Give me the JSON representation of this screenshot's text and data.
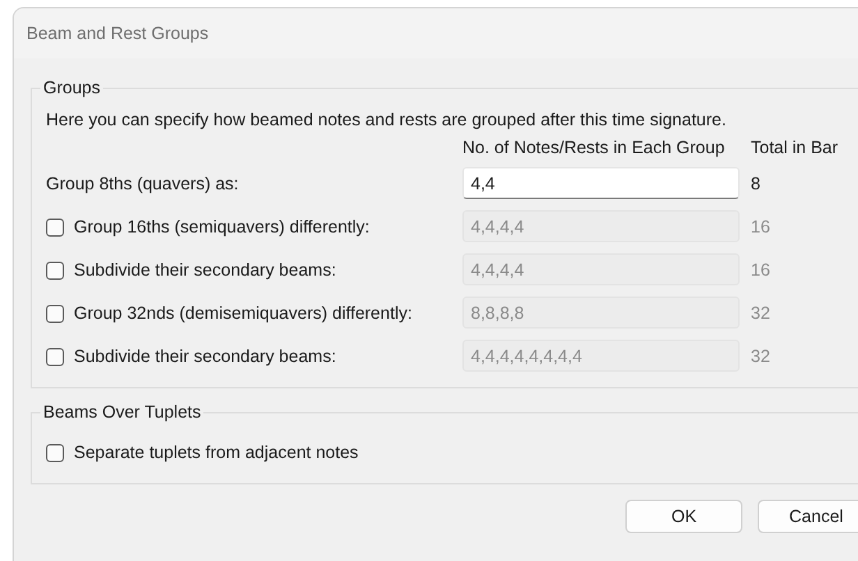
{
  "window": {
    "title": "Beam and Rest Groups"
  },
  "groups": {
    "legend": "Groups",
    "description": "Here you can specify how beamed notes and rests are grouped after this time signature.",
    "columns": [
      "No. of Notes/Rests in Each Group",
      "Total in Bar"
    ],
    "rows": [
      {
        "kind": "label",
        "label": "Group 8ths (quavers) as:",
        "value": "4,4",
        "total": "8",
        "disabled": false
      },
      {
        "kind": "checkbox",
        "label": "Group 16ths (semiquavers) differently:",
        "checked": false,
        "value": "4,4,4,4",
        "total": "16",
        "disabled": true
      },
      {
        "kind": "checkbox",
        "label": "Subdivide their secondary beams:",
        "checked": false,
        "value": "4,4,4,4",
        "total": "16",
        "disabled": true
      },
      {
        "kind": "checkbox",
        "label": "Group 32nds (demisemiquavers) differently:",
        "checked": false,
        "value": "8,8,8,8",
        "total": "32",
        "disabled": true
      },
      {
        "kind": "checkbox",
        "label": "Subdivide their secondary beams:",
        "checked": false,
        "value": "4,4,4,4,4,4,4,4",
        "total": "32",
        "disabled": true
      }
    ]
  },
  "tuplets": {
    "legend": "Beams Over Tuplets",
    "options": [
      {
        "label": "Separate tuplets from adjacent notes",
        "checked": false
      }
    ]
  },
  "buttons": [
    "OK",
    "Cancel"
  ]
}
